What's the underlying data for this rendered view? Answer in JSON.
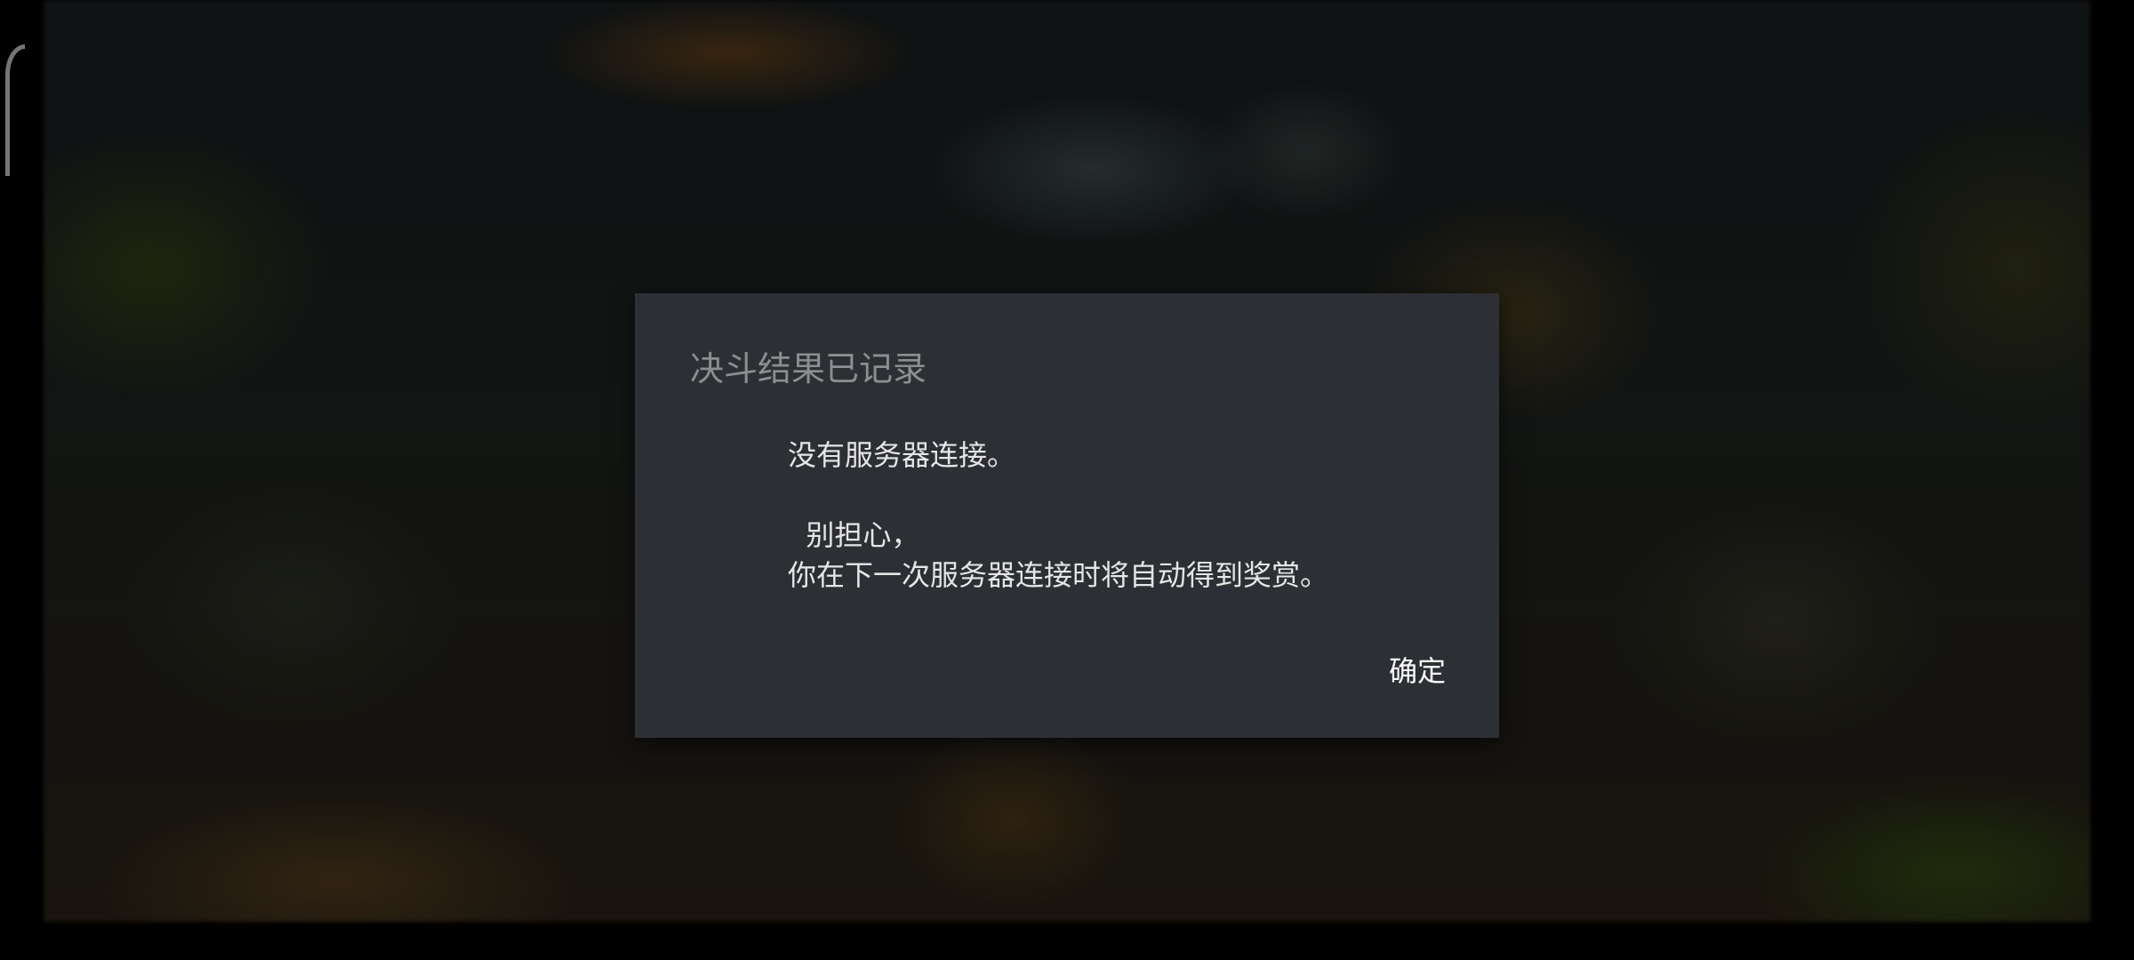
{
  "dialog": {
    "title": "决斗结果已记录",
    "message_lines": [
      "没有服务器连接。",
      "",
      "  别担心，",
      "你在下一次服务器连接时将自动得到奖赏。"
    ],
    "confirm_label": "确定"
  },
  "colors": {
    "dialog_background": "#2c2f33",
    "title_text": "#8d8e90",
    "body_text": "#e6e6e6",
    "button_text": "#ffffff"
  }
}
